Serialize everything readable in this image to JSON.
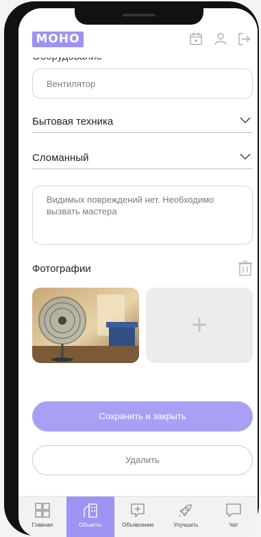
{
  "header": {
    "logo_text": "МОНО",
    "icons": [
      "calendar-icon",
      "user-icon",
      "logout-icon"
    ]
  },
  "form": {
    "equipment_label": "Оборудование",
    "equipment_value": "Вентилятор",
    "category_value": "Бытовая техника",
    "condition_value": "Сломанный",
    "description_value": "Видимых повреждений нет. Необходимо вызвать мастера",
    "photos_title": "Фотографии",
    "add_photo_symbol": "+"
  },
  "actions": {
    "save_label": "Сохранить и закрыть",
    "delete_label": "Удалить"
  },
  "tabbar": {
    "tabs": [
      {
        "label": "Главная",
        "icon": "grid-icon",
        "active": false
      },
      {
        "label": "Объекты",
        "icon": "building-icon",
        "active": true
      },
      {
        "label": "Объявление",
        "icon": "announcement-icon",
        "active": false
      },
      {
        "label": "Улучшить",
        "icon": "rocket-icon",
        "active": false
      },
      {
        "label": "Чат",
        "icon": "chat-icon",
        "active": false
      }
    ]
  },
  "colors": {
    "accent": "#9d93f2",
    "primary_button": "#a9a0f6"
  }
}
